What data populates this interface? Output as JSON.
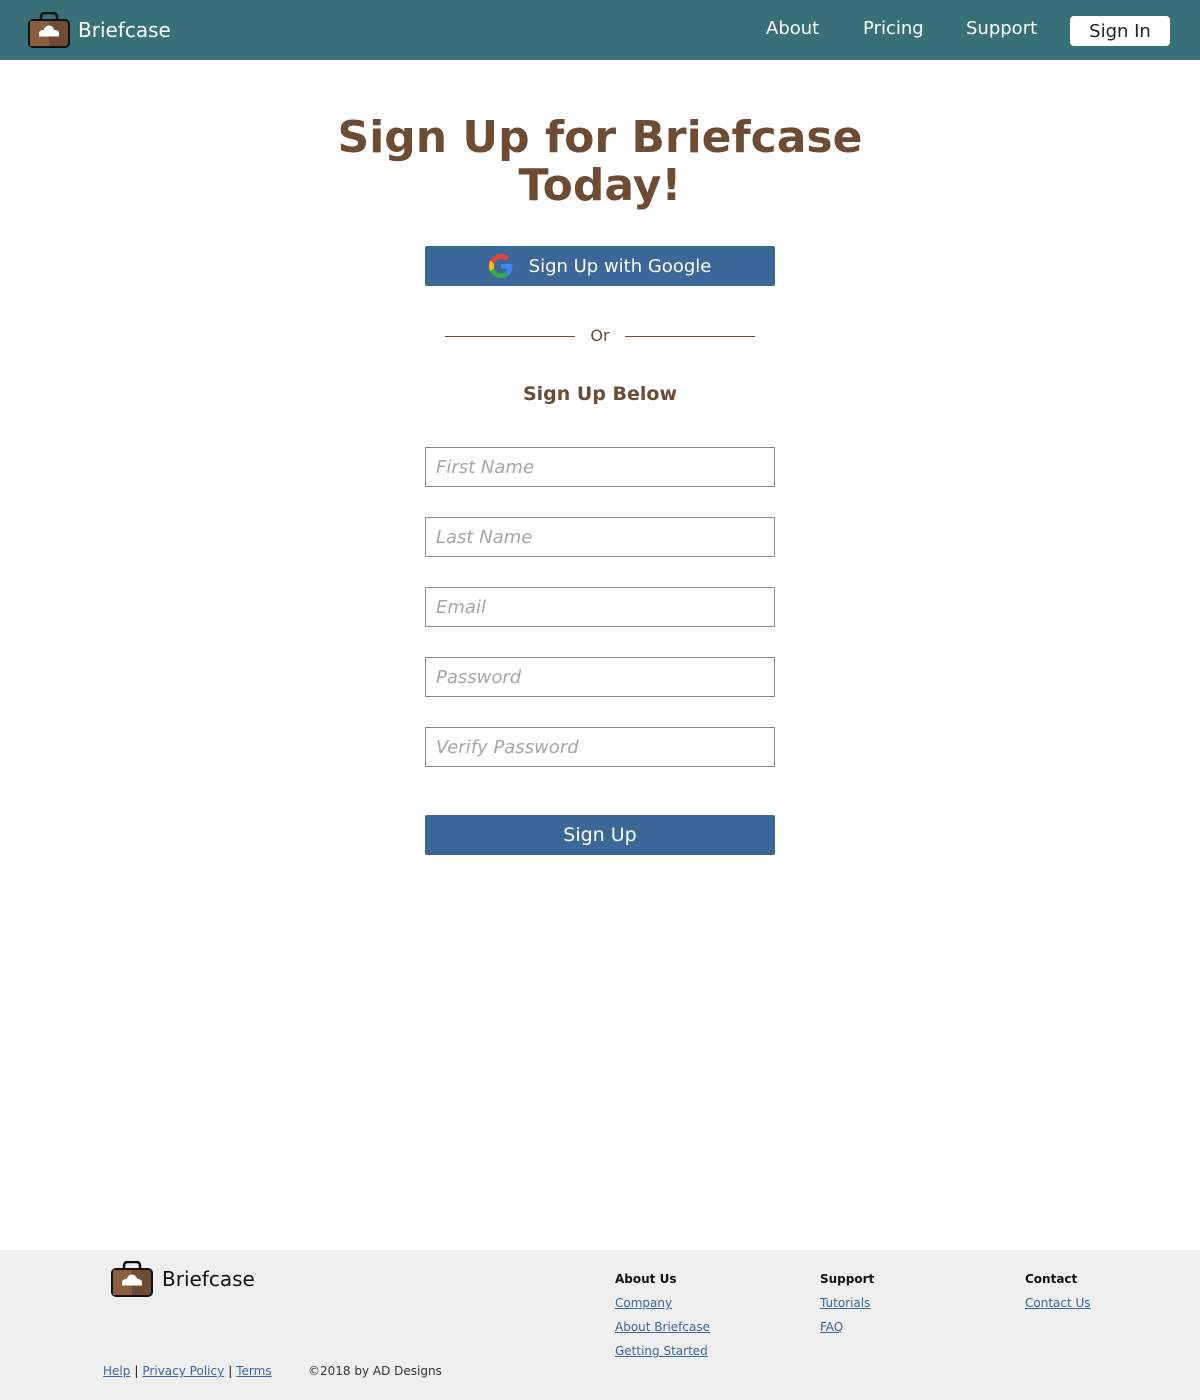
{
  "colors": {
    "nav_bg": "#377076",
    "brand_brown": "#6e4b33",
    "button_blue": "#3b6899",
    "footer_bg": "#efefef",
    "link_blue": "#3b6899"
  },
  "nav": {
    "brand": "Briefcase",
    "logo_icon": "briefcase-cloud-icon",
    "links": [
      "About",
      "Pricing",
      "Support"
    ],
    "signin_label": "Sign In"
  },
  "main": {
    "title": "Sign Up for Briefcase Today!",
    "google_button": {
      "label": "Sign Up with Google",
      "icon": "google-icon"
    },
    "divider_text": "Or",
    "subheading": "Sign Up Below",
    "fields": [
      {
        "placeholder": "First Name",
        "value": ""
      },
      {
        "placeholder": "Last Name",
        "value": ""
      },
      {
        "placeholder": "Email",
        "value": ""
      },
      {
        "placeholder": "Password",
        "value": ""
      },
      {
        "placeholder": "Verify Password",
        "value": ""
      }
    ],
    "submit_label": "Sign Up"
  },
  "footer": {
    "brand": "Briefcase",
    "columns": [
      {
        "heading": "About Us",
        "links": [
          "Company",
          "About Briefcase",
          "Getting Started"
        ]
      },
      {
        "heading": "Support",
        "links": [
          "Tutorials",
          "FAQ"
        ]
      },
      {
        "heading": "Contact",
        "links": [
          "Contact Us"
        ]
      }
    ],
    "legal_links": [
      "Help",
      "Privacy Policy",
      "Terms"
    ],
    "legal_separator": "|",
    "copyright": "©2018 by AD Designs"
  }
}
